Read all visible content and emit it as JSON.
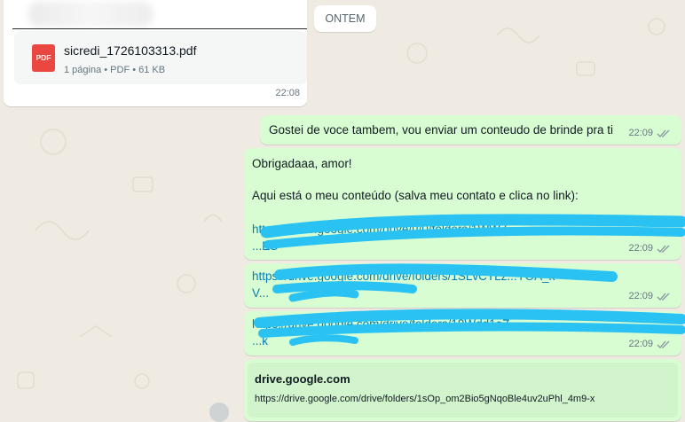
{
  "date_divider": "ONTEM",
  "messages": {
    "file": {
      "name": "sicredi_1726103313.pdf",
      "info": "1 página • PDF • 61 KB",
      "icon_label": "PDF",
      "time": "22:08"
    },
    "msg1": {
      "text": "Gostei de voce tambem, vou enviar um conteudo de brinde pra ti",
      "time": "22:09"
    },
    "msg2": {
      "line1": "Obrigadaaa, amor!",
      "line2": "Aqui está o meu conteúdo (salva meu contato e clica no link):",
      "link_line1": "https://drive.google.com/drive/u/0/folders/1WW7...",
      "link_line2": "...ES",
      "time": "22:09"
    },
    "msg3": {
      "link_line1": "https://drive.google.com/drive/folders/1SLvCTLz...YOA_k-",
      "link_line2": "V...",
      "time": "22:09"
    },
    "msg4": {
      "link_line1": "https://drive.google.com/drive/folders/18Wdd1oZ...",
      "link_line2": "...k",
      "time": "22:09"
    },
    "preview": {
      "domain": "drive.google.com",
      "url": "https://drive.google.com/drive/folders/1sOp_om2Bio5gNqoBle4uv2uPhl_4m9-x"
    }
  },
  "colors": {
    "incoming": "#ffffff",
    "outgoing": "#d9fdd3",
    "link": "#027eb5",
    "scribble": "#29c2f2",
    "pdf": "#e9473f"
  }
}
